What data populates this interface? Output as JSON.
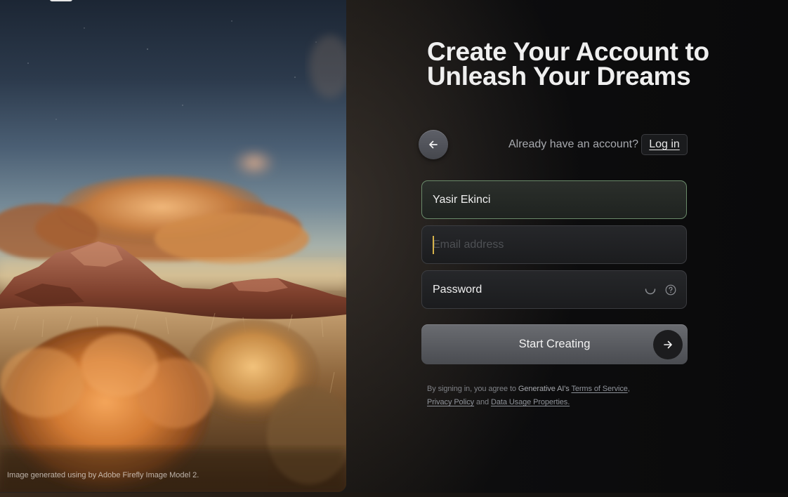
{
  "hero": {
    "credit": "Image generated using by Adobe Firefly Image Model 2."
  },
  "header": {
    "title_line1": "Create Your Account to",
    "title_line2": "Unleash Your Dreams"
  },
  "nav": {
    "back_icon": "arrow-left-icon",
    "already_text": "Already have an account?",
    "login_label": "Log in"
  },
  "form": {
    "name_value": "Yasir Ekinci",
    "email_placeholder": "Email address",
    "email_value": "",
    "password_placeholder": "Password",
    "password_icons": [
      "loading-spinner-icon",
      "question-circle-icon"
    ],
    "submit_label": "Start Creating",
    "submit_icon": "arrow-right-icon"
  },
  "legal": {
    "prefix": "By signing in, you agree to ",
    "company": "Generative AI's",
    "terms": "Terms of Service",
    "comma": ",",
    "privacy": "Privacy Policy",
    "and": " and ",
    "data_usage": "Data Usage Properties."
  },
  "colors": {
    "accent_focus_border": "#6a8a6a",
    "caret": "#d6b24a"
  }
}
